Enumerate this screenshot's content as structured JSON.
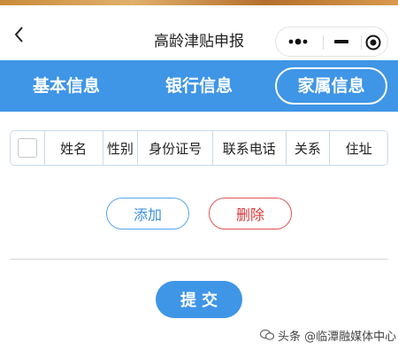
{
  "header": {
    "title": "高龄津贴申报"
  },
  "tabs": [
    {
      "label": "基本信息"
    },
    {
      "label": "银行信息"
    },
    {
      "label": "家属信息"
    }
  ],
  "table": {
    "headers": [
      "姓名",
      "性别",
      "身份证号",
      "联系电话",
      "关系",
      "住址"
    ]
  },
  "actions": {
    "add_label": "添加",
    "delete_label": "删除",
    "submit_label": "提交"
  },
  "watermark": {
    "text": "头条 @临潭融媒体中心"
  },
  "colors": {
    "primary": "#3f95e6",
    "danger": "#d63a3a"
  },
  "icons": [
    "back-arrow-icon",
    "more-dots-icon",
    "minimize-icon",
    "close-target-icon",
    "wechat-icon"
  ]
}
